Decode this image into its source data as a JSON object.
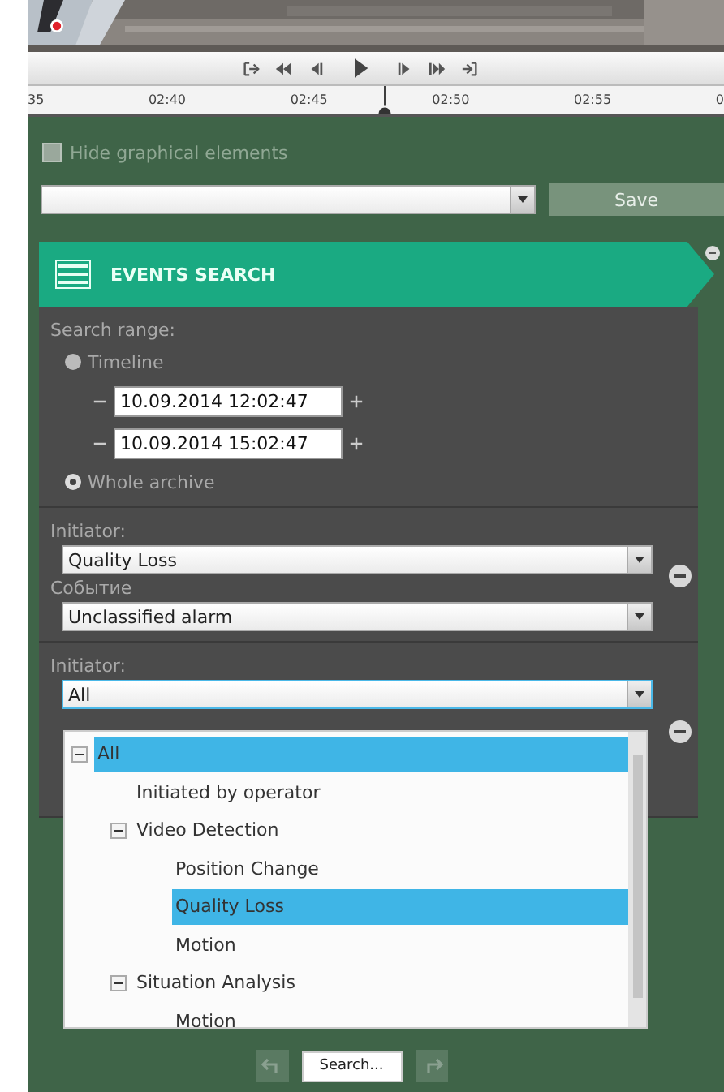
{
  "timeline": {
    "ticks": [
      "35",
      "02:40",
      "02:45",
      "02:50",
      "02:55",
      "0"
    ]
  },
  "hide_graphical_elements": {
    "label": "Hide graphical elements",
    "checked": false
  },
  "save_button": "Save",
  "panel": {
    "title": "EVENTS SEARCH",
    "search_range": {
      "label": "Search range:",
      "options": [
        {
          "label": "Timeline",
          "selected": false
        },
        {
          "label": "Whole archive",
          "selected": true
        }
      ],
      "dates": [
        "10.09.2014 12:02:47",
        "10.09.2014 15:02:47"
      ]
    },
    "filters": [
      {
        "initiator_label": "Initiator:",
        "initiator": "Quality Loss",
        "event_label": "Событие",
        "event": "Unclassified alarm",
        "open": false
      },
      {
        "initiator_label": "Initiator:",
        "initiator": "All",
        "open": true,
        "options": [
          {
            "label": "All",
            "selected": true,
            "expanded": true,
            "children": [
              {
                "label": "Initiated by operator",
                "selected": false
              },
              {
                "label": "Video Detection",
                "selected": false,
                "expanded": true,
                "children": [
                  {
                    "label": "Position Change",
                    "selected": false
                  },
                  {
                    "label": "Quality Loss",
                    "selected": true
                  },
                  {
                    "label": "Motion",
                    "selected": false
                  }
                ]
              },
              {
                "label": "Situation Analysis",
                "selected": false,
                "expanded": true,
                "children": [
                  {
                    "label": "Motion",
                    "selected": false
                  }
                ]
              }
            ]
          }
        ]
      }
    ]
  },
  "search_button": "Search..."
}
